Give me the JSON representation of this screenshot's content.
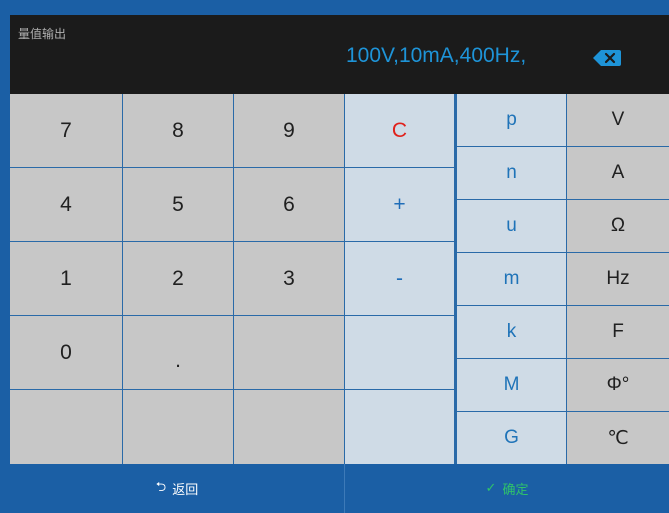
{
  "display": {
    "label": "量值输出",
    "value": "100V,10mA,400Hz,",
    "backspace_icon": "backspace-icon"
  },
  "keypad": {
    "digits": [
      "7",
      "8",
      "9",
      "4",
      "5",
      "6",
      "1",
      "2",
      "3",
      "0",
      "."
    ],
    "ops": [
      "C",
      "+",
      "-"
    ]
  },
  "prefixes": [
    "p",
    "n",
    "u",
    "m",
    "k",
    "M",
    "G"
  ],
  "units": [
    "V",
    "A",
    "Ω",
    "Hz",
    "F",
    "Φ°",
    "℃"
  ],
  "bottom": {
    "back_label": "返回",
    "confirm_label": "确定"
  },
  "colors": {
    "accent": "#1b5fa5",
    "display_text": "#1e94d8",
    "clear": "#e0211b",
    "confirm": "#2fc36a"
  }
}
